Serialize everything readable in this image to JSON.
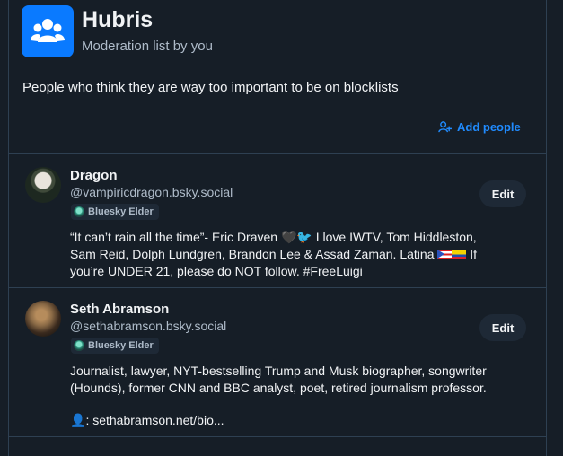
{
  "list": {
    "title": "Hubris",
    "subtitle": "Moderation list by you",
    "description": "People who think they are way too important to be on blocklists",
    "add_people_label": "Add people",
    "icon": "people-group-icon"
  },
  "members": [
    {
      "name": "Dragon",
      "handle": "@vampiricdragon.bsky.social",
      "badge": "Bluesky Elder",
      "edit_label": "Edit",
      "bio": {
        "line1a": "“It can’t rain all the time”- Eric Draven ",
        "line1b": " I love IWTV, Tom Hiddleston,",
        "line2a": "Sam Reid, Dolph Lundgren, Brandon Lee & Assad Zaman. Latina ",
        "line2b": " If",
        "line3": "you’re UNDER 21, please do NOT follow. #FreeLuigi"
      }
    },
    {
      "name": "Seth Abramson",
      "handle": "@sethabramson.bsky.social",
      "badge": "Bluesky Elder",
      "edit_label": "Edit",
      "bio": {
        "line1": "Journalist, lawyer, NYT-bestselling Trump and Musk biographer, songwriter",
        "line2": "(Hounds), former CNN and BBC analyst, poet, retired journalism professor.",
        "line3": ": sethabramson.net/bio..."
      }
    }
  ],
  "colors": {
    "background": "#161e27",
    "accent": "#208bfe",
    "list_avatar": "#0a7aff",
    "border": "#2e4052"
  }
}
